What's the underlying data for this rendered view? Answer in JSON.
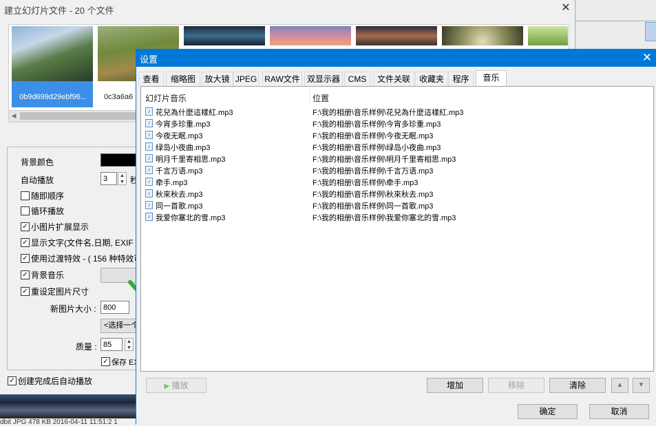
{
  "bg_window": {
    "title": "建立幻灯片文件 - 20 个文件",
    "close_glyph": "✕",
    "thumbnails": [
      {
        "label": "0b9d699d29ebf96..."
      },
      {
        "label": "0c3a6a6"
      }
    ],
    "options": {
      "bg_color_label": "背景颜色",
      "auto_play_label": "自动播放",
      "auto_play_value": "3",
      "auto_play_unit": "秒",
      "random_order_label": "随即顺序",
      "loop_label": "循环播放",
      "small_expand_label": "小图片扩展显示",
      "show_text_label": "显示文字(文件名,日期, EXIF 信",
      "transition_label": "使用过渡特效 - ( 156 种特效可",
      "bg_music_label": "背景音乐",
      "resize_label": "重设定图片尺寸",
      "new_size_label": "新图片大小 :",
      "new_size_value": "800",
      "choose_label": "<选择一个",
      "quality_label": "质量 :",
      "quality_value": "85",
      "save_exif_label": "保存 EX",
      "autoplay_after_label": "创建完成后自动播放"
    },
    "status_text": "dbit  JPG   478 KB   2016-04-11 11:51:2  1"
  },
  "dialog": {
    "title": "设置",
    "close_glyph": "✕",
    "tabs": [
      "查看",
      "缩略图",
      "放大镜",
      "JPEG",
      "RAW文件",
      "双显示器",
      "CMS",
      "文件关联",
      "收藏夹",
      "程序",
      "音乐"
    ],
    "active_tab": "音乐",
    "columns": {
      "name": "幻灯片音乐",
      "path": "位置"
    },
    "rows": [
      {
        "name": "花兒為什麼這樣紅.mp3",
        "path": "F:\\我的相册\\音乐样例\\花兒為什麼這樣紅.mp3"
      },
      {
        "name": "今宵多珍重.mp3",
        "path": "F:\\我的相册\\音乐样例\\今宵多珍重.mp3"
      },
      {
        "name": "今夜无眠.mp3",
        "path": "F:\\我的相册\\音乐样例\\今夜无眠.mp3"
      },
      {
        "name": "绿岛小夜曲.mp3",
        "path": "F:\\我的相册\\音乐样例\\绿岛小夜曲.mp3"
      },
      {
        "name": "明月千里寄相思.mp3",
        "path": "F:\\我的相册\\音乐样例\\明月千里寄相思.mp3"
      },
      {
        "name": "千言万语.mp3",
        "path": "F:\\我的相册\\音乐样例\\千言万语.mp3"
      },
      {
        "name": "牵手.mp3",
        "path": "F:\\我的相册\\音乐样例\\牵手.mp3"
      },
      {
        "name": "秋來秋去.mp3",
        "path": "F:\\我的相册\\音乐样例\\秋來秋去.mp3"
      },
      {
        "name": "同一首歌.mp3",
        "path": "F:\\我的相册\\音乐样例\\同一首歌.mp3"
      },
      {
        "name": "我爱你塞北的雪.mp3",
        "path": "F:\\我的相册\\音乐样例\\我爱你塞北的雪.mp3"
      }
    ],
    "buttons": {
      "play": "播放",
      "add": "增加",
      "remove": "移除",
      "clear": "清除",
      "up_glyph": "▲",
      "down_glyph": "▼",
      "ok": "确定",
      "cancel": "取消"
    },
    "accent_color": "#0078d7"
  }
}
